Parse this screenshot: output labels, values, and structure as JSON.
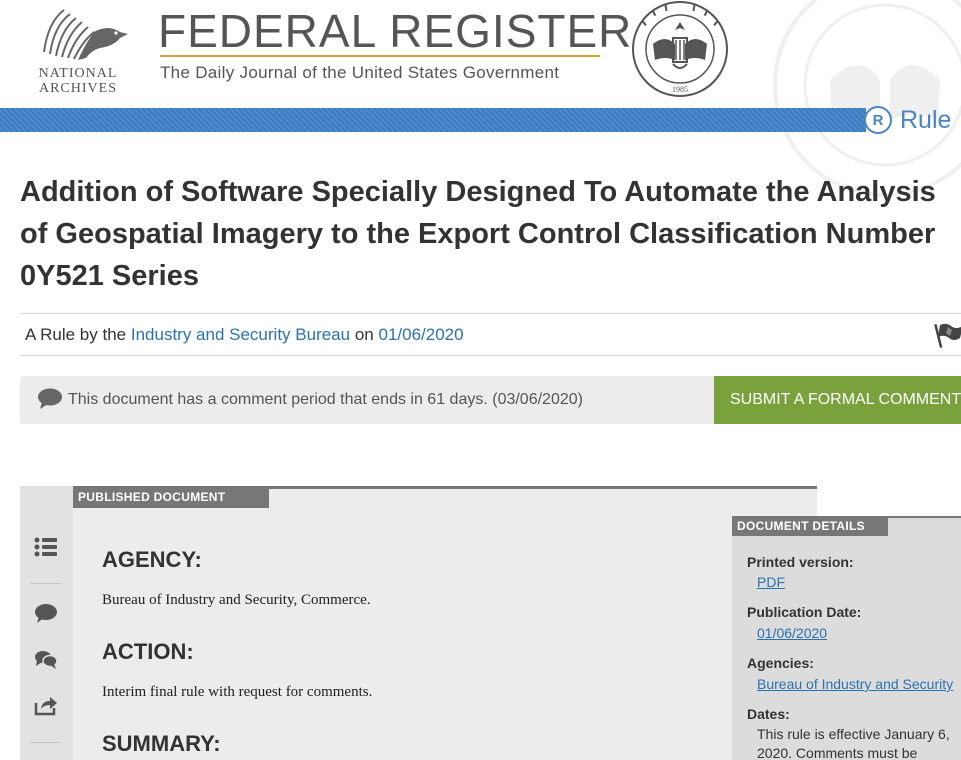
{
  "header": {
    "archives_line1": "NATIONAL",
    "archives_line2": "ARCHIVES",
    "site_title": "FEDERAL REGISTER",
    "site_subtitle": "The Daily Journal of the United States Government",
    "seal_year": "1985"
  },
  "document_type": {
    "icon_letter": "R",
    "label": "Rule"
  },
  "document": {
    "title": "Addition of Software Specially Designed To Automate the Analysis of Geospatial Imagery to the Export Control Classification Number 0Y521 Series",
    "byline_prefix": "A Rule by the",
    "agency_link": "Industry and Security Bureau",
    "byline_on": "on",
    "date_link": "01/06/2020"
  },
  "comment_bar": {
    "message": "This document has a comment period that ends in 61 days. (03/06/2020)",
    "submit_label": "SUBMIT A FORMAL COMMENT"
  },
  "published_document": {
    "label": "PUBLISHED DOCUMENT",
    "sections": [
      {
        "heading": "AGENCY:",
        "body": "Bureau of Industry and Security, Commerce."
      },
      {
        "heading": "ACTION:",
        "body": "Interim final rule with request for comments."
      },
      {
        "heading": "SUMMARY:",
        "body": ""
      }
    ]
  },
  "document_details": {
    "label": "DOCUMENT DETAILS",
    "printed_version_label": "Printed version:",
    "printed_version_value": "PDF",
    "publication_date_label": "Publication Date:",
    "publication_date_value": "01/06/2020",
    "agencies_label": "Agencies:",
    "agencies_value": "Bureau of Industry and Security",
    "dates_label": "Dates:",
    "dates_value": "This rule is effective January 6, 2020. Comments must be"
  },
  "icons": {
    "side_nav": [
      "list-icon",
      "comment-icon",
      "comments-icon",
      "share-icon"
    ],
    "flag": "flag-icon"
  },
  "colors": {
    "brand_blue": "#4a84c4",
    "link_blue": "#2b72b1",
    "submit_green": "#79a23d",
    "header_gold": "#d9a33a"
  }
}
